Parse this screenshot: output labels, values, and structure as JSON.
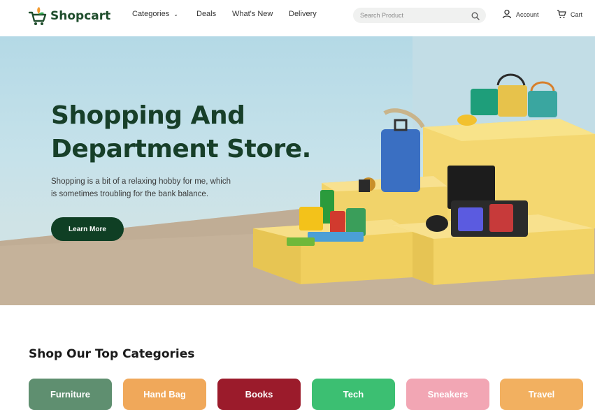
{
  "brand": {
    "name": "Shopcart"
  },
  "nav": {
    "categories": "Categories",
    "deals": "Deals",
    "whats_new": "What's New",
    "delivery": "Delivery"
  },
  "search": {
    "placeholder": "Search Product"
  },
  "header": {
    "account": "Account",
    "cart": "Cart"
  },
  "hero": {
    "title_line1": "Shopping And",
    "title_line2": "Department Store.",
    "description_line1": "Shopping is a bit of a relaxing hobby for me, which",
    "description_line2": "is sometimes troubling for the bank balance.",
    "cta": "Learn More"
  },
  "categories_section": {
    "title": "Shop Our Top Categories",
    "items": [
      {
        "label": "Furniture",
        "color": "#5f8f70"
      },
      {
        "label": "Hand Bag",
        "color": "#f0a85a"
      },
      {
        "label": "Books",
        "color": "#9b1b2b"
      },
      {
        "label": "Tech",
        "color": "#3cbf72"
      },
      {
        "label": "Sneakers",
        "color": "#f2a6b4"
      },
      {
        "label": "Travel",
        "color": "#f2b060"
      }
    ]
  },
  "colors": {
    "brand_green": "#0f3f24",
    "accent_yellow": "#f3d36a"
  }
}
